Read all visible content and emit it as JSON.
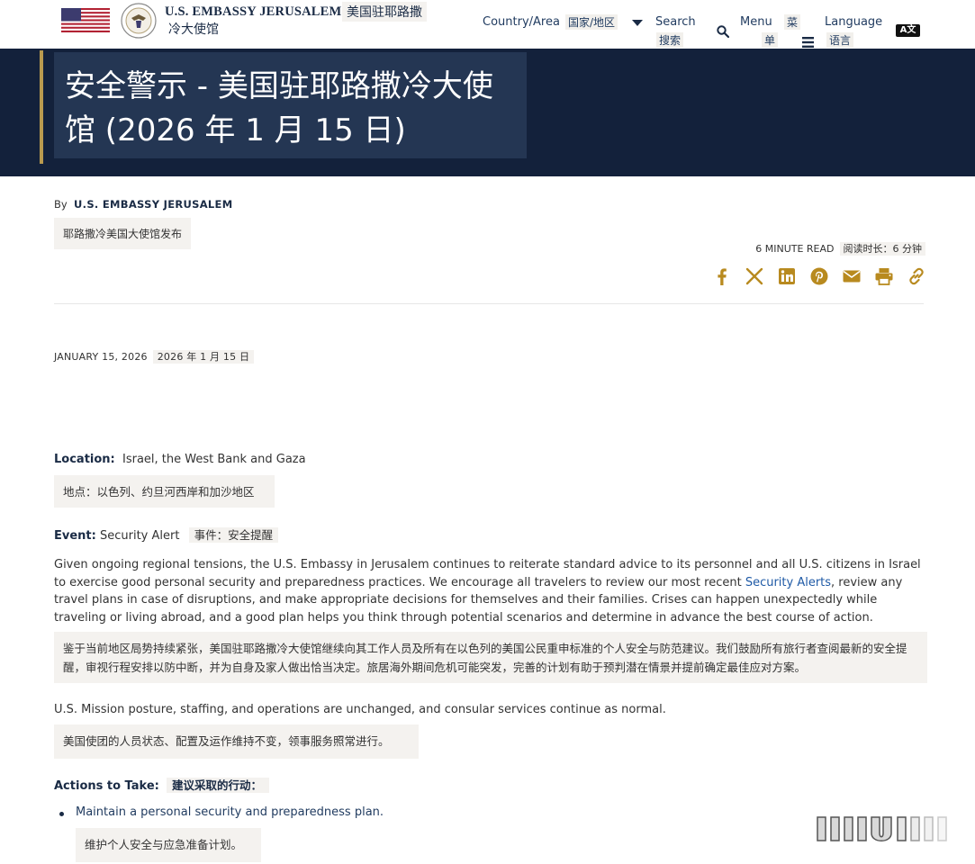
{
  "header": {
    "brand_en": "U.S. EMBASSY JERUSALEM",
    "brand_zh_line1": "美国驻耶路撒",
    "brand_zh_line2": "冷大使馆",
    "country_label": "Country/Area",
    "country_label_zh": "国家/地区",
    "search_label": "Search",
    "search_label_zh": "搜索",
    "menu_label": "Menu",
    "menu_label_zh_1": "菜",
    "menu_label_zh_2": "单",
    "language_label": "Language",
    "language_label_zh": "语言",
    "language_icon_text": "A文"
  },
  "hero": {
    "title_line1": "安全警示 - 美国驻耶路撒冷大使",
    "title_line2": "馆 (2026 年 1 月 15 日)"
  },
  "meta": {
    "by_prefix": "By",
    "author": "U.S. EMBASSY JERUSALEM",
    "author_zh": "耶路撒冷美国大使馆发布",
    "read_time": "6 MINUTE READ",
    "read_time_zh": "阅读时长：6 分钟",
    "date": "JANUARY 15, 2026",
    "date_zh": "2026 年 1 月 15 日"
  },
  "share_icons": [
    "facebook-icon",
    "x-icon",
    "linkedin-icon",
    "pinterest-icon",
    "email-icon",
    "print-icon",
    "link-icon"
  ],
  "body": {
    "location_label": "Location:",
    "location_value": "Israel, the West Bank and Gaza",
    "location_zh": "地点：以色列、约旦河西岸和加沙地区",
    "event_label": "Event:",
    "event_value": "Security Alert",
    "event_zh": "事件：安全提醒",
    "para1_before_link": "Given ongoing regional tensions, the U.S. Embassy in Jerusalem continues to reiterate standard advice to its personnel and all U.S. citizens in Israel to exercise good personal security and preparedness practices. We encourage all travelers to review our most recent ",
    "para1_link": "Security Alerts",
    "para1_after_link": ", review any travel plans in case of disruptions, and make appropriate decisions for themselves and their families. Crises can happen unexpectedly while traveling or living abroad, and a good plan helps you think through potential scenarios and determine in advance the best course of action.",
    "para1_zh": "鉴于当前地区局势持续紧张，美国驻耶路撒冷大使馆继续向其工作人员及所有在以色列的美国公民重申标准的个人安全与防范建议。我们鼓励所有旅行者查阅最新的安全提醒，审视行程安排以防中断，并为自身及家人做出恰当决定。旅居海外期间危机可能突发，完善的计划有助于预判潜在情景并提前确定最佳应对方案。",
    "para2": "U.S. Mission posture, staffing, and operations are unchanged, and consular services continue as normal.",
    "para2_zh": "美国使团的人员状态、配置及运作维持不变，领事服务照常进行。",
    "actions_label": "Actions to Take:",
    "actions_zh": "建议采取的行动：",
    "action1": "Maintain a personal security and preparedness plan.",
    "action1_zh": "维护个人安全与应急准备计划。"
  },
  "colors": {
    "navy": "#13213b",
    "hero_box": "#243653",
    "gold": "#b99a4f",
    "zh_bg": "#f4f2ef",
    "link": "#1f5aa6"
  }
}
